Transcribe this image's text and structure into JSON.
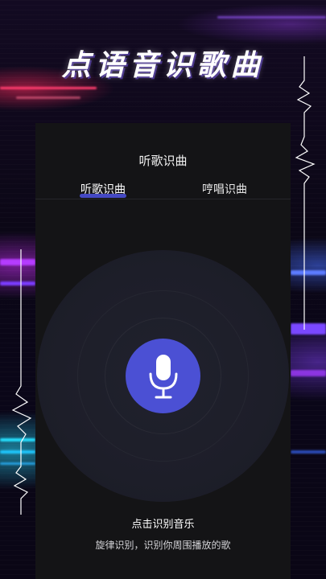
{
  "banner": {
    "title": "点语音识歌曲"
  },
  "panel": {
    "title": "听歌识曲",
    "tabs": [
      {
        "label": "听歌识曲",
        "active": true
      },
      {
        "label": "哼唱识曲",
        "active": false
      }
    ],
    "mic_button_icon": "microphone-icon",
    "cta": "点击识别音乐",
    "hint": "旋律识别，识别你周围播放的歌"
  },
  "colors": {
    "accent": "#4b50d4",
    "panel_bg": "#141416",
    "circle_bg": "#1f202b"
  }
}
